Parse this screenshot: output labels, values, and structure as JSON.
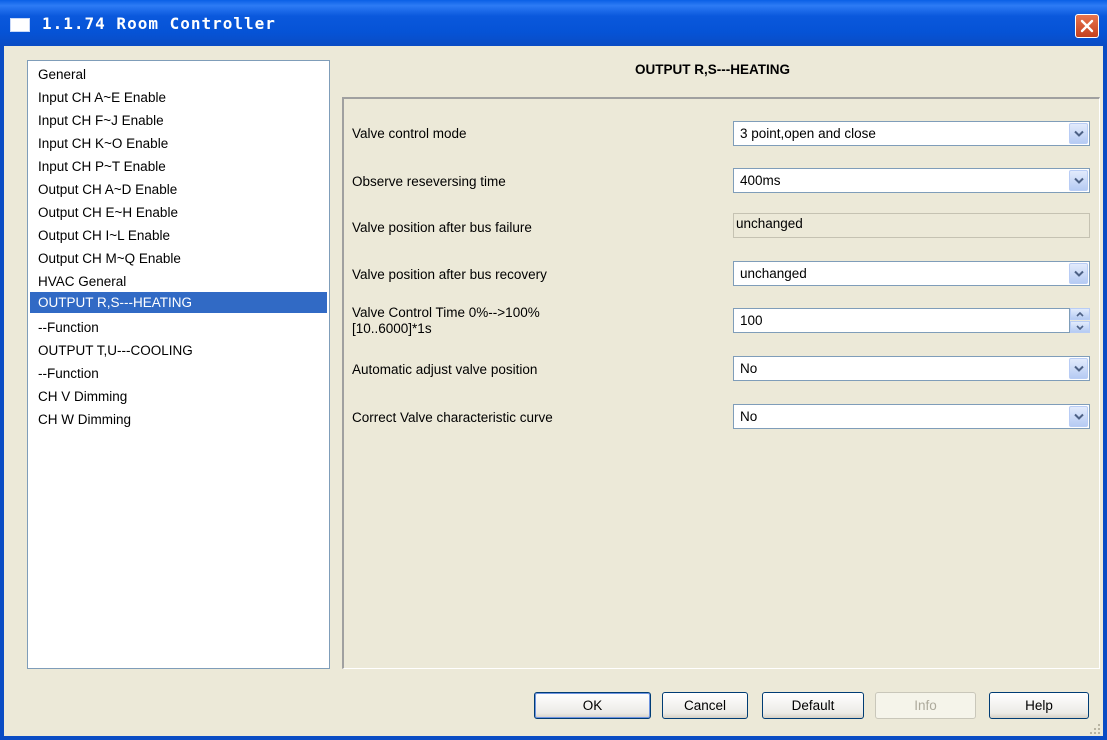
{
  "window": {
    "title": "1.1.74 Room Controller"
  },
  "tree": {
    "items": [
      {
        "label": "General"
      },
      {
        "label": "Input CH A~E Enable"
      },
      {
        "label": "Input CH F~J Enable"
      },
      {
        "label": "Input CH K~O Enable"
      },
      {
        "label": "Input CH P~T Enable"
      },
      {
        "label": "Output CH A~D Enable"
      },
      {
        "label": "Output CH E~H Enable"
      },
      {
        "label": "Output CH I~L Enable"
      },
      {
        "label": "Output CH M~Q Enable"
      },
      {
        "label": "HVAC General"
      },
      {
        "label": "OUTPUT R,S---HEATING",
        "selected": true
      },
      {
        "label": "--Function"
      },
      {
        "label": "OUTPUT T,U---COOLING"
      },
      {
        "label": "--Function"
      },
      {
        "label": "CH V Dimming"
      },
      {
        "label": "CH W Dimming"
      }
    ]
  },
  "page": {
    "title": "OUTPUT R,S---HEATING"
  },
  "params": {
    "valve_control_mode": {
      "label": "Valve control mode",
      "value": "3 point,open and close"
    },
    "observe_reversing_time": {
      "label": "Observe reseversing time",
      "value": "400ms"
    },
    "valve_pos_bus_failure": {
      "label": "Valve position after bus failure",
      "value": "unchanged"
    },
    "valve_pos_bus_recovery": {
      "label": "Valve position after bus recovery",
      "value": "unchanged"
    },
    "valve_control_time": {
      "label_line1": "Valve Control Time 0%-->100%",
      "label_line2": "[10..6000]*1s",
      "value": "100"
    },
    "auto_adjust_valve": {
      "label": "Automatic adjust valve position",
      "value": "No"
    },
    "correct_valve_curve": {
      "label": "Correct Valve characteristic curve",
      "value": "No"
    }
  },
  "buttons": {
    "ok": "OK",
    "cancel": "Cancel",
    "default": "Default",
    "info": "Info",
    "help": "Help"
  },
  "colors": {
    "titlebar": "#0A58DC",
    "selection": "#316AC5",
    "dialog_bg": "#ECE9D8"
  }
}
